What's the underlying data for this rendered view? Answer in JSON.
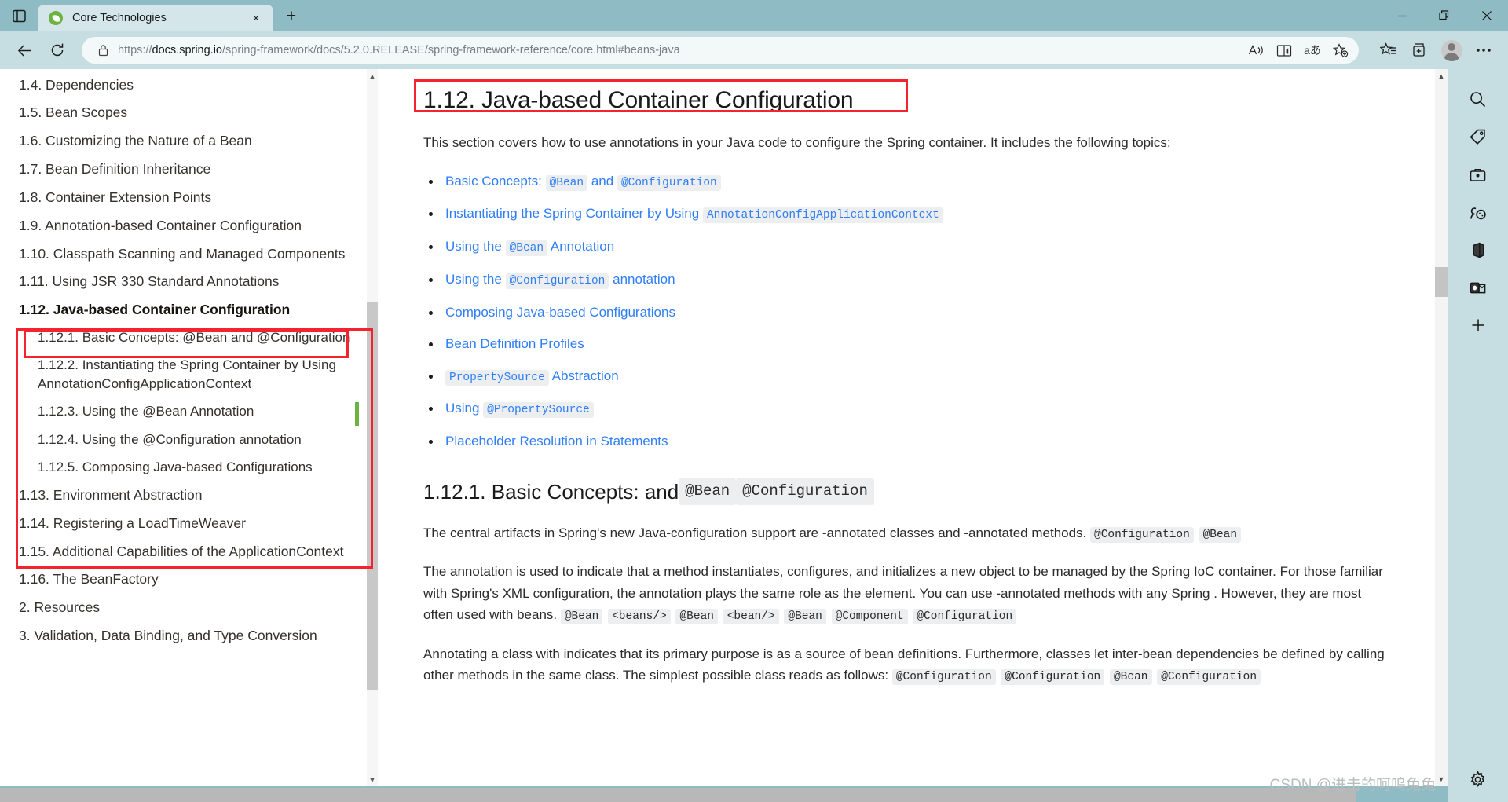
{
  "window": {
    "tab_title": "Core Technologies",
    "tab_close_label": "×",
    "new_tab_label": "+",
    "minimize_label": "—",
    "restore_label": "❐",
    "close_label": "✕"
  },
  "toolbar": {
    "url_prefix": "https://",
    "url_domain": "docs.spring.io",
    "url_path": "/spring-framework/docs/5.2.0.RELEASE/spring-framework-reference/core.html#beans-java",
    "url_full": "https://docs.spring.io/spring-framework/docs/5.2.0.RELEASE/spring-framework-reference/core.html#beans-java",
    "read_aloud_label": "A",
    "translate_label": "aあ"
  },
  "toc": {
    "items": [
      {
        "label": "1.4. Dependencies",
        "level": 1,
        "active": false
      },
      {
        "label": "1.5. Bean Scopes",
        "level": 1,
        "active": false
      },
      {
        "label": "1.6. Customizing the Nature of a Bean",
        "level": 1,
        "active": false
      },
      {
        "label": "1.7. Bean Definition Inheritance",
        "level": 1,
        "active": false
      },
      {
        "label": "1.8. Container Extension Points",
        "level": 1,
        "active": false
      },
      {
        "label": "1.9. Annotation-based Container Configuration",
        "level": 1,
        "active": false
      },
      {
        "label": "1.10. Classpath Scanning and Managed Components",
        "level": 1,
        "active": false
      },
      {
        "label": "1.11. Using JSR 330 Standard Annotations",
        "level": 1,
        "active": false
      },
      {
        "label": "1.12. Java-based Container Configuration",
        "level": 1,
        "active": true
      },
      {
        "label": "1.12.1. Basic Concepts: @Bean and @Configuration",
        "level": 2,
        "active": false
      },
      {
        "label": "1.12.2. Instantiating the Spring Container by Using AnnotationConfigApplicationContext",
        "level": 2,
        "active": false
      },
      {
        "label": "1.12.3. Using the @Bean Annotation",
        "level": 2,
        "active": false
      },
      {
        "label": "1.12.4. Using the @Configuration annotation",
        "level": 2,
        "active": false
      },
      {
        "label": "1.12.5. Composing Java-based Configurations",
        "level": 2,
        "active": false
      },
      {
        "label": "1.13. Environment Abstraction",
        "level": 1,
        "active": false
      },
      {
        "label": "1.14. Registering a LoadTimeWeaver",
        "level": 1,
        "active": false
      },
      {
        "label": "1.15. Additional Capabilities of the ApplicationContext",
        "level": 1,
        "active": false
      },
      {
        "label": "1.16. The BeanFactory",
        "level": 1,
        "active": false
      },
      {
        "label": "2. Resources",
        "level": 1,
        "active": false
      },
      {
        "label": "3. Validation, Data Binding, and Type Conversion",
        "level": 1,
        "active": false
      }
    ]
  },
  "content": {
    "title": "1.12. Java-based Container Configuration",
    "intro": "This section covers how to use annotations in your Java code to configure the Spring container. It includes the following topics:",
    "links": [
      {
        "parts": [
          {
            "t": "Basic Concepts:",
            "code": false
          },
          {
            "t": "@Bean",
            "code": true
          },
          {
            "t": "and",
            "code": false
          },
          {
            "t": "@Configuration",
            "code": true
          }
        ]
      },
      {
        "parts": [
          {
            "t": "Instantiating the Spring Container by Using",
            "code": false
          },
          {
            "t": "AnnotationConfigApplicationContext",
            "code": true
          }
        ]
      },
      {
        "parts": [
          {
            "t": "Using the",
            "code": false
          },
          {
            "t": "@Bean",
            "code": true
          },
          {
            "t": "Annotation",
            "code": false
          }
        ]
      },
      {
        "parts": [
          {
            "t": "Using the",
            "code": false
          },
          {
            "t": "@Configuration",
            "code": true
          },
          {
            "t": "annotation",
            "code": false
          }
        ]
      },
      {
        "parts": [
          {
            "t": "Composing Java-based Configurations",
            "code": false
          }
        ]
      },
      {
        "parts": [
          {
            "t": "Bean Definition Profiles",
            "code": false
          }
        ]
      },
      {
        "parts": [
          {
            "t": "PropertySource",
            "code": true
          },
          {
            "t": "Abstraction",
            "code": false
          }
        ]
      },
      {
        "parts": [
          {
            "t": "Using",
            "code": false
          },
          {
            "t": "@PropertySource",
            "code": true
          }
        ]
      },
      {
        "parts": [
          {
            "t": "Placeholder Resolution in Statements",
            "code": false
          }
        ]
      }
    ],
    "section_heading": {
      "text": "1.12.1. Basic Concepts: and",
      "codes": [
        "@Bean",
        "@Configuration"
      ]
    },
    "paragraphs": [
      {
        "text": "The central artifacts in Spring's new Java-configuration support are -annotated classes and -annotated methods.",
        "codes": [
          "@Configuration",
          "@Bean"
        ]
      },
      {
        "text": "The annotation is used to indicate that a method instantiates, configures, and initializes a new object to be managed by the Spring IoC container. For those familiar with Spring's XML configuration, the annotation plays the same role as the element. You can use -annotated methods with any Spring . However, they are most often used with beans.",
        "codes": [
          "@Bean",
          "<beans/>",
          "@Bean",
          "<bean/>",
          "@Bean",
          "@Component",
          "@Configuration"
        ]
      },
      {
        "text": "Annotating a class with indicates that its primary purpose is as a source of bean definitions. Furthermore, classes let inter-bean dependencies be defined by calling other methods in the same class. The simplest possible class reads as follows:",
        "codes": [
          "@Configuration",
          "@Configuration",
          "@Bean",
          "@Configuration"
        ]
      }
    ]
  },
  "watermark": "CSDN @进击的呵呜兔兔",
  "colors": {
    "chrome": "#8fbcc4",
    "toolbar": "#c6dde2",
    "link": "#2f7ef7",
    "annotation_red": "#f5232d",
    "active_green": "#6db33f"
  }
}
